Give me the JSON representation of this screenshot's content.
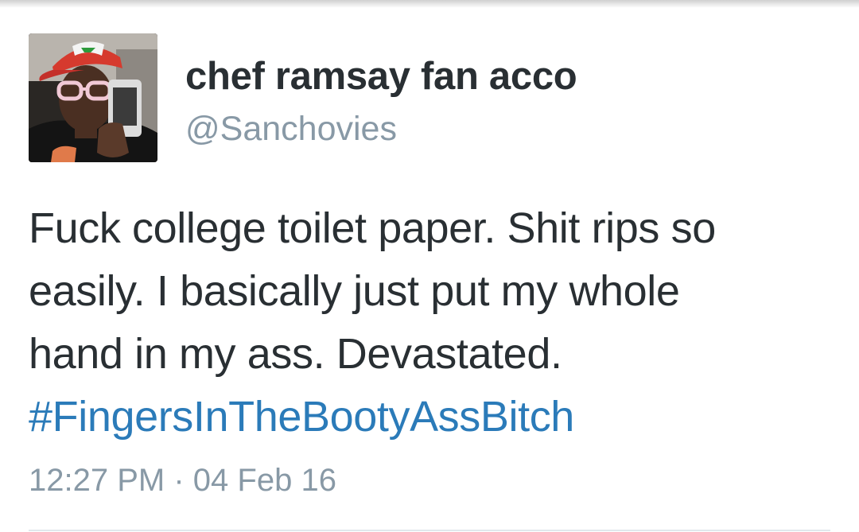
{
  "tweet": {
    "author": {
      "display_name": "chef ramsay fan acco",
      "handle": "@Sanchovies"
    },
    "text_lines": [
      "Fuck college toilet paper. Shit rips so",
      "easily. I basically just put my whole",
      "hand in my ass. Devastated."
    ],
    "hashtag": "#FingersInTheBootyAssBitch",
    "time": "12:27 PM",
    "separator": "·",
    "date": "04 Feb 16"
  },
  "colors": {
    "text": "#292f33",
    "secondary": "#8899a6",
    "hashtag": "#2b7bb9",
    "divider": "#e1e8ed"
  }
}
